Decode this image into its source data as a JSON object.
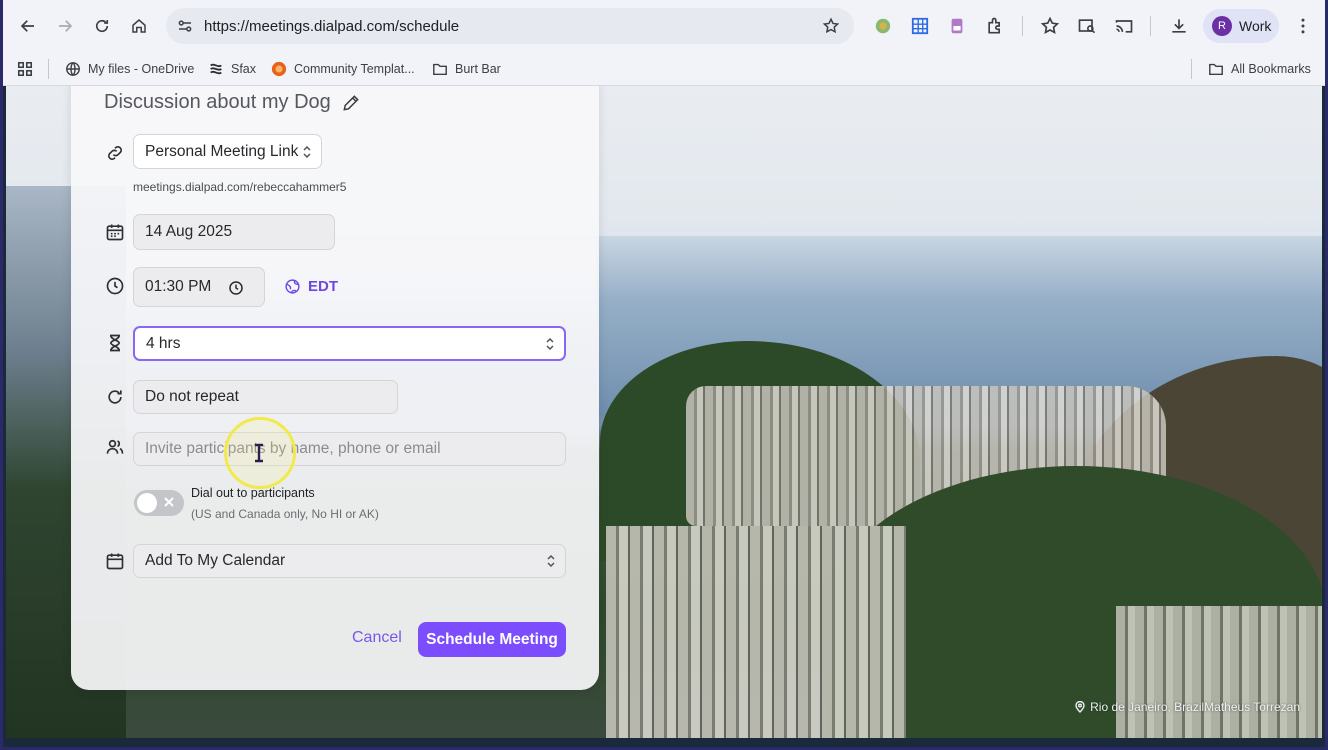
{
  "browser": {
    "url": "https://meetings.dialpad.com/schedule",
    "profile_initial": "R",
    "profile_label": "Work",
    "bookmarks": [
      {
        "label": "My files - OneDrive",
        "icon": "globe-icon"
      },
      {
        "label": "Sfax",
        "icon": "sfax-icon"
      },
      {
        "label": "Community Templat...",
        "icon": "community-icon"
      },
      {
        "label": "Burt Bar",
        "icon": "folder-icon"
      }
    ],
    "all_bookmarks": "All Bookmarks"
  },
  "dialog": {
    "title": "Discussion about my Dog",
    "meeting_link": "Personal Meeting Link",
    "meeting_url": "meetings.dialpad.com/rebeccahammer5",
    "date": "14 Aug 2025",
    "time": "01:30 PM",
    "timezone": "EDT",
    "duration": "4 hrs",
    "repeat": "Do not repeat",
    "participants_placeholder": "Invite participants by name, phone or email",
    "dial_out_label": "Dial out to participants",
    "dial_out_note": "(US and Canada only, No HI or AK)",
    "dial_out_enabled": false,
    "calendar": "Add To My Calendar",
    "cancel_label": "Cancel",
    "schedule_label": "Schedule Meeting"
  },
  "background": {
    "credit": "Rio de Janeiro, BrazilMatheus Torrezan"
  },
  "colors": {
    "accent": "#7c4dff",
    "focus_border": "#8a66f2",
    "cursor_highlight": "#f2e94a"
  }
}
